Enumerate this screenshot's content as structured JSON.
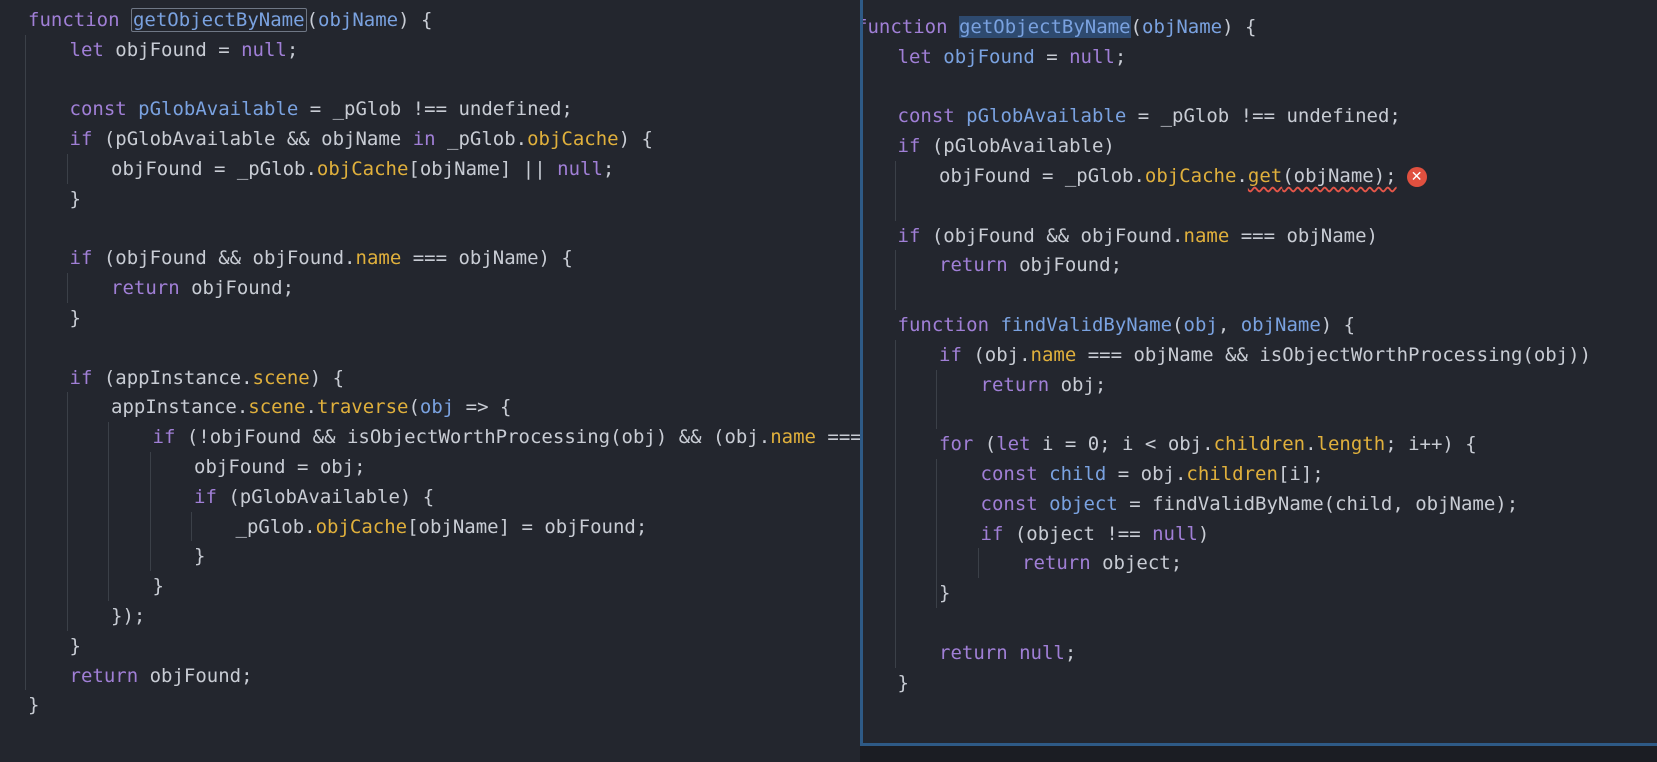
{
  "left_editor": {
    "lines": [
      [
        [
          "kw",
          "function "
        ],
        [
          "fn-box",
          "getObjectByName"
        ],
        [
          "var",
          "("
        ],
        [
          "param",
          "objName"
        ],
        [
          "var",
          ") {"
        ]
      ],
      [
        [
          "kw",
          "let "
        ],
        [
          "var",
          "objFound = "
        ],
        [
          "kw",
          "null"
        ],
        [
          "var",
          ";"
        ]
      ],
      [],
      [
        [
          "kw",
          "const "
        ],
        [
          "param",
          "pGlobAvailable"
        ],
        [
          "var",
          " = _pGlob !== undefined;"
        ]
      ],
      [
        [
          "kw",
          "if "
        ],
        [
          "var",
          "(pGlobAvailable && objName "
        ],
        [
          "kw",
          "in"
        ],
        [
          "var",
          " _pGlob."
        ],
        [
          "prop",
          "objCache"
        ],
        [
          "var",
          ") {"
        ]
      ],
      [
        [
          "var",
          "objFound = _pGlob."
        ],
        [
          "prop",
          "objCache"
        ],
        [
          "var",
          "[objName] || "
        ],
        [
          "kw",
          "null"
        ],
        [
          "var",
          ";"
        ]
      ],
      [
        [
          "var",
          "}"
        ]
      ],
      [],
      [
        [
          "kw",
          "if "
        ],
        [
          "var",
          "(objFound && objFound."
        ],
        [
          "prop",
          "name"
        ],
        [
          "var",
          " === objName) {"
        ]
      ],
      [
        [
          "kw",
          "return "
        ],
        [
          "var",
          "objFound;"
        ]
      ],
      [
        [
          "var",
          "}"
        ]
      ],
      [],
      [
        [
          "kw",
          "if "
        ],
        [
          "var",
          "(appInstance."
        ],
        [
          "prop",
          "scene"
        ],
        [
          "var",
          ") {"
        ]
      ],
      [
        [
          "var",
          "appInstance."
        ],
        [
          "prop",
          "scene"
        ],
        [
          "var",
          "."
        ],
        [
          "prop",
          "traverse"
        ],
        [
          "var",
          "("
        ],
        [
          "param",
          "obj"
        ],
        [
          "var",
          " => {"
        ]
      ],
      [
        [
          "kw",
          "if "
        ],
        [
          "var",
          "(!objFound && isObjectWorthProcessing(obj) && (obj."
        ],
        [
          "prop",
          "name"
        ],
        [
          "var",
          " === o"
        ]
      ],
      [
        [
          "var",
          "objFound = obj;"
        ]
      ],
      [
        [
          "kw",
          "if "
        ],
        [
          "var",
          "(pGlobAvailable) {"
        ]
      ],
      [
        [
          "var",
          "_pGlob."
        ],
        [
          "prop",
          "objCache"
        ],
        [
          "var",
          "[objName] = objFound;"
        ]
      ],
      [
        [
          "var",
          "}"
        ]
      ],
      [
        [
          "var",
          "}"
        ]
      ],
      [
        [
          "var",
          "});"
        ]
      ],
      [
        [
          "var",
          "}"
        ]
      ],
      [
        [
          "kw",
          "return "
        ],
        [
          "var",
          "objFound;"
        ]
      ],
      [
        [
          "var",
          "}"
        ]
      ]
    ]
  },
  "right_editor": {
    "lines": [
      [
        [
          "kw",
          "function "
        ],
        [
          "fn-sel",
          "getObjectByName"
        ],
        [
          "var",
          "("
        ],
        [
          "param",
          "objName"
        ],
        [
          "var",
          ") {"
        ]
      ],
      [
        [
          "kw",
          "let "
        ],
        [
          "param",
          "objFound"
        ],
        [
          "var",
          " = "
        ],
        [
          "kw",
          "null"
        ],
        [
          "var",
          ";"
        ]
      ],
      [],
      [
        [
          "kw",
          "const "
        ],
        [
          "param",
          "pGlobAvailable"
        ],
        [
          "var",
          " = _pGlob !== undefined;"
        ]
      ],
      [
        [
          "kw",
          "if "
        ],
        [
          "var",
          "(pGlobAvailable)"
        ]
      ],
      [
        [
          "var",
          "objFound = _pGlob."
        ],
        [
          "prop",
          "objCache"
        ],
        [
          "var",
          "."
        ],
        [
          "prop-sq",
          "get"
        ],
        [
          "sq",
          "(objName);"
        ],
        [
          "err",
          ""
        ]
      ],
      [],
      [
        [
          "kw",
          "if "
        ],
        [
          "var",
          "(objFound && objFound."
        ],
        [
          "prop",
          "name"
        ],
        [
          "var",
          " === objName)"
        ]
      ],
      [
        [
          "kw",
          "return "
        ],
        [
          "var",
          "objFound;"
        ]
      ],
      [],
      [
        [
          "kw",
          "function "
        ],
        [
          "fn",
          "findValidByName"
        ],
        [
          "var",
          "("
        ],
        [
          "param",
          "obj"
        ],
        [
          "var",
          ", "
        ],
        [
          "param",
          "objName"
        ],
        [
          "var",
          ") {"
        ]
      ],
      [
        [
          "kw",
          "if "
        ],
        [
          "var",
          "(obj."
        ],
        [
          "prop",
          "name"
        ],
        [
          "var",
          " === objName && isObjectWorthProcessing(obj))"
        ]
      ],
      [
        [
          "kw",
          "return "
        ],
        [
          "var",
          "obj;"
        ]
      ],
      [],
      [
        [
          "kw",
          "for "
        ],
        [
          "var",
          "("
        ],
        [
          "kw",
          "let "
        ],
        [
          "var",
          "i = 0; i < obj."
        ],
        [
          "prop",
          "children"
        ],
        [
          "var",
          "."
        ],
        [
          "prop",
          "length"
        ],
        [
          "var",
          "; i++) {"
        ]
      ],
      [
        [
          "kw",
          "const "
        ],
        [
          "param",
          "child"
        ],
        [
          "var",
          " = obj."
        ],
        [
          "prop",
          "children"
        ],
        [
          "var",
          "[i];"
        ]
      ],
      [
        [
          "kw",
          "const "
        ],
        [
          "param",
          "object"
        ],
        [
          "var",
          " = findValidByName(child, objName);"
        ]
      ],
      [
        [
          "kw",
          "if "
        ],
        [
          "var",
          "(object !== "
        ],
        [
          "kw",
          "null"
        ],
        [
          "var",
          ")"
        ]
      ],
      [
        [
          "kw",
          "return "
        ],
        [
          "var",
          "object;"
        ]
      ],
      [
        [
          "var",
          "}"
        ]
      ],
      [],
      [
        [
          "kw",
          "return "
        ],
        [
          "kw",
          "null"
        ],
        [
          "var",
          ";"
        ]
      ],
      [
        [
          "var",
          "}"
        ]
      ]
    ]
  },
  "error": {
    "icon": "close-circle-icon",
    "symbol": "✕"
  },
  "colors": {
    "background": "#23262e",
    "keyword": "#a07fd6",
    "function": "#7aa2e0",
    "property": "#e0b03c",
    "text": "#c8ccd4",
    "error": "#e0503f",
    "pane_border": "#2e5a86"
  }
}
